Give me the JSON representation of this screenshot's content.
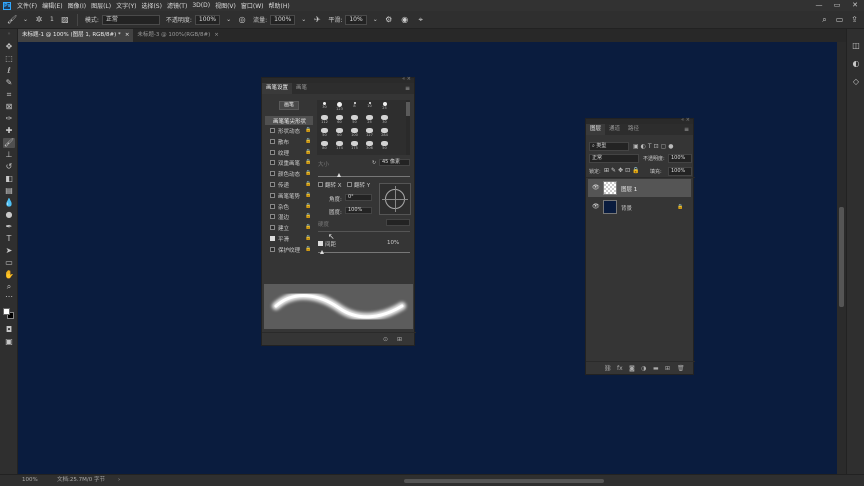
{
  "menubar": {
    "app_icon": "Ps",
    "items": [
      "文件(F)",
      "编辑(E)",
      "图像(I)",
      "图层(L)",
      "文字(Y)",
      "选择(S)",
      "滤镜(T)",
      "3D(D)",
      "视图(V)",
      "窗口(W)",
      "帮助(H)"
    ],
    "window_controls": [
      "—",
      "▭",
      "✕"
    ]
  },
  "options": {
    "brush_size": "1",
    "mode_label": "模式:",
    "mode_value": "正常",
    "opacity_label": "不透明度:",
    "opacity_value": "100%",
    "flow_label": "流量:",
    "flow_value": "100%",
    "smooth_label": "平滑:",
    "smooth_value": "10%"
  },
  "tabs": [
    {
      "label": "未标题-1 @ 100% (图层 1, RGB/8#) *",
      "close": "×"
    },
    {
      "label": "未标题-3 @ 100%(RGB/8#)",
      "close": "×"
    }
  ],
  "brush_panel": {
    "tabs": [
      "画笔设置",
      "画笔"
    ],
    "preset_button": "画笔",
    "tip_shape_label": "画笔笔尖形状",
    "options": [
      {
        "label": "形状动态",
        "checked": false
      },
      {
        "label": "散布",
        "checked": false
      },
      {
        "label": "纹理",
        "checked": false
      },
      {
        "label": "双重画笔",
        "checked": false
      },
      {
        "label": "颜色动态",
        "checked": false
      },
      {
        "label": "传递",
        "checked": false
      },
      {
        "label": "画笔笔势",
        "checked": false
      },
      {
        "label": "杂色",
        "checked": false
      },
      {
        "label": "湿边",
        "checked": false
      },
      {
        "label": "建立",
        "checked": false
      },
      {
        "label": "平滑",
        "checked": true
      },
      {
        "label": "保护纹理",
        "checked": false
      }
    ],
    "presets_row1": [
      "30",
      "123",
      "8",
      "10",
      "25"
    ],
    "presets_row2": [
      "112",
      "60",
      "50",
      "25",
      "30"
    ],
    "presets_row3": [
      "50",
      "60",
      "100",
      "127",
      "284"
    ],
    "presets_row4": [
      "80",
      "174",
      "175",
      "306",
      "50"
    ],
    "size_label": "大小",
    "size_value": "45 像素",
    "flip_x": "翻转 X",
    "flip_y": "翻转 Y",
    "angle_label": "角度:",
    "angle_value": "0°",
    "roundness_label": "圆度:",
    "roundness_value": "100%",
    "hardness_label": "硬度",
    "spacing_label": "间距",
    "spacing_checked": true,
    "spacing_value": "10%"
  },
  "layers_panel": {
    "tabs": [
      "图层",
      "通道",
      "路径"
    ],
    "filter_value": "类型",
    "blend_value": "正常",
    "opacity_label": "不透明度:",
    "opacity_value": "100%",
    "lock_label": "锁定:",
    "fill_label": "填充:",
    "fill_value": "100%",
    "layers": [
      {
        "name": "图层 1",
        "selected": true
      },
      {
        "name": "背景",
        "selected": false
      }
    ]
  },
  "status": {
    "zoom": "100%",
    "doc_info": "文档:25.7M/0 字节"
  },
  "colors": {
    "canvas": "#0a1c3e",
    "selection": "#31a8ff"
  }
}
